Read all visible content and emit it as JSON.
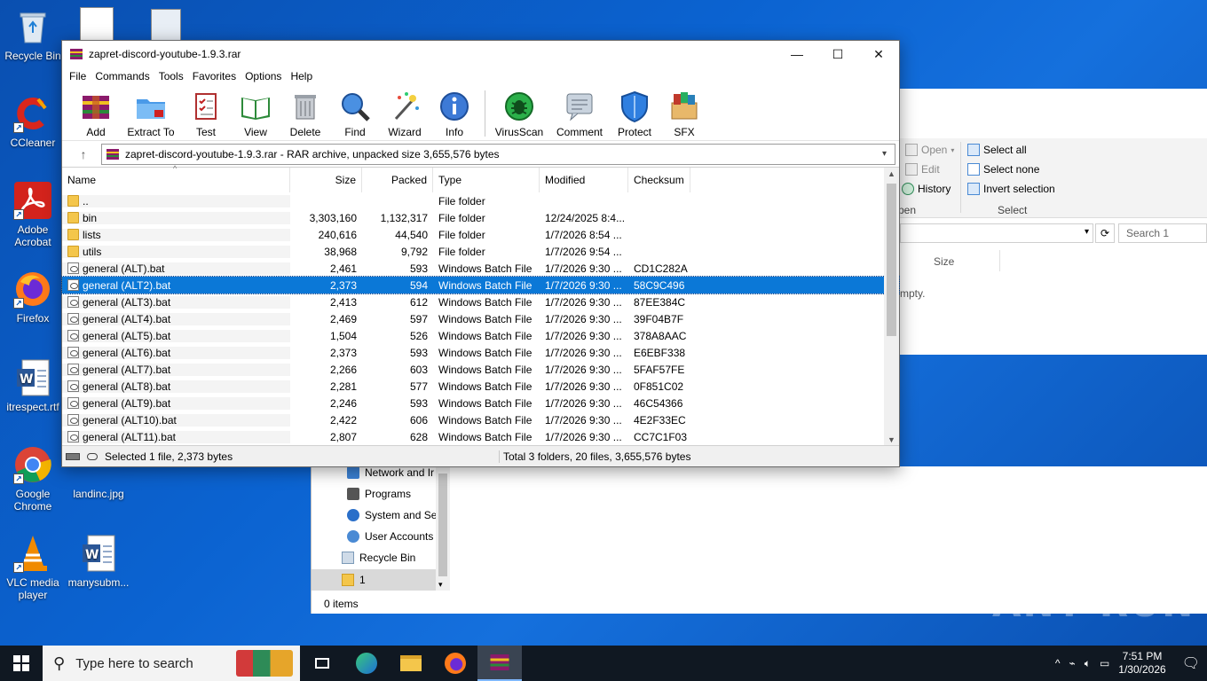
{
  "desktop": {
    "icons": [
      {
        "label": "Recycle Bin"
      },
      {
        "label": "CCleaner"
      },
      {
        "label": "Adobe Acrobat"
      },
      {
        "label": "Firefox"
      },
      {
        "label": "itrespect.rtf"
      },
      {
        "label": "Google Chrome"
      },
      {
        "label": "landinc.jpg"
      },
      {
        "label": "VLC media player"
      },
      {
        "label": "manysubm..."
      }
    ]
  },
  "explorer": {
    "ribbon": {
      "open": "Open",
      "edit": "Edit",
      "history": "History",
      "open_group": "pen",
      "select_all": "Select all",
      "select_none": "Select none",
      "invert_selection": "Invert selection",
      "select_group": "Select"
    },
    "search_placeholder": "Search 1",
    "size_col": "Size",
    "empty_text": "mpty.",
    "nav": [
      {
        "label": "Network and Ir"
      },
      {
        "label": "Programs"
      },
      {
        "label": "System and Se"
      },
      {
        "label": "User Accounts"
      },
      {
        "label": "Recycle Bin"
      },
      {
        "label": "1"
      }
    ],
    "status": "0 items"
  },
  "winrar": {
    "title": "zapret-discord-youtube-1.9.3.rar",
    "menu": [
      "File",
      "Commands",
      "Tools",
      "Favorites",
      "Options",
      "Help"
    ],
    "toolbar": [
      "Add",
      "Extract To",
      "Test",
      "View",
      "Delete",
      "Find",
      "Wizard",
      "Info",
      "VirusScan",
      "Comment",
      "Protect",
      "SFX"
    ],
    "path": "zapret-discord-youtube-1.9.3.rar - RAR archive, unpacked size 3,655,576 bytes",
    "columns": {
      "name": "Name",
      "size": "Size",
      "packed": "Packed",
      "type": "Type",
      "modified": "Modified",
      "checksum": "Checksum"
    },
    "rows": [
      {
        "name": "..",
        "size": "",
        "packed": "",
        "type": "File folder",
        "modified": "",
        "checksum": "",
        "kind": "folder"
      },
      {
        "name": "bin",
        "size": "3,303,160",
        "packed": "1,132,317",
        "type": "File folder",
        "modified": "12/24/2025 8:4...",
        "checksum": "",
        "kind": "folder"
      },
      {
        "name": "lists",
        "size": "240,616",
        "packed": "44,540",
        "type": "File folder",
        "modified": "1/7/2026 8:54 ...",
        "checksum": "",
        "kind": "folder"
      },
      {
        "name": "utils",
        "size": "38,968",
        "packed": "9,792",
        "type": "File folder",
        "modified": "1/7/2026 9:54 ...",
        "checksum": "",
        "kind": "folder"
      },
      {
        "name": "general (ALT).bat",
        "size": "2,461",
        "packed": "593",
        "type": "Windows Batch File",
        "modified": "1/7/2026 9:30 ...",
        "checksum": "CD1C282A",
        "kind": "bat"
      },
      {
        "name": "general (ALT2).bat",
        "size": "2,373",
        "packed": "594",
        "type": "Windows Batch File",
        "modified": "1/7/2026 9:30 ...",
        "checksum": "58C9C496",
        "kind": "bat",
        "selected": true
      },
      {
        "name": "general (ALT3).bat",
        "size": "2,413",
        "packed": "612",
        "type": "Windows Batch File",
        "modified": "1/7/2026 9:30 ...",
        "checksum": "87EE384C",
        "kind": "bat"
      },
      {
        "name": "general (ALT4).bat",
        "size": "2,469",
        "packed": "597",
        "type": "Windows Batch File",
        "modified": "1/7/2026 9:30 ...",
        "checksum": "39F04B7F",
        "kind": "bat"
      },
      {
        "name": "general (ALT5).bat",
        "size": "1,504",
        "packed": "526",
        "type": "Windows Batch File",
        "modified": "1/7/2026 9:30 ...",
        "checksum": "378A8AAC",
        "kind": "bat"
      },
      {
        "name": "general (ALT6).bat",
        "size": "2,373",
        "packed": "593",
        "type": "Windows Batch File",
        "modified": "1/7/2026 9:30 ...",
        "checksum": "E6EBF338",
        "kind": "bat"
      },
      {
        "name": "general (ALT7).bat",
        "size": "2,266",
        "packed": "603",
        "type": "Windows Batch File",
        "modified": "1/7/2026 9:30 ...",
        "checksum": "5FAF57FE",
        "kind": "bat"
      },
      {
        "name": "general (ALT8).bat",
        "size": "2,281",
        "packed": "577",
        "type": "Windows Batch File",
        "modified": "1/7/2026 9:30 ...",
        "checksum": "0F851C02",
        "kind": "bat"
      },
      {
        "name": "general (ALT9).bat",
        "size": "2,246",
        "packed": "593",
        "type": "Windows Batch File",
        "modified": "1/7/2026 9:30 ...",
        "checksum": "46C54366",
        "kind": "bat"
      },
      {
        "name": "general (ALT10).bat",
        "size": "2,422",
        "packed": "606",
        "type": "Windows Batch File",
        "modified": "1/7/2026 9:30 ...",
        "checksum": "4E2F33EC",
        "kind": "bat"
      },
      {
        "name": "general (ALT11).bat",
        "size": "2,807",
        "packed": "628",
        "type": "Windows Batch File",
        "modified": "1/7/2026 9:30 ...",
        "checksum": "CC7C1F03",
        "kind": "bat"
      }
    ],
    "status_left": "Selected 1 file, 2,373 bytes",
    "status_right": "Total 3 folders, 20 files, 3,655,576 bytes"
  },
  "taskbar": {
    "search_placeholder": "Type here to search",
    "time": "7:51 PM",
    "date": "1/30/2026"
  },
  "watermark": "ANY RUN",
  "colors": {
    "selection": "#0b78d7",
    "taskbar": "#101822",
    "desktop": "#0b63d1"
  }
}
